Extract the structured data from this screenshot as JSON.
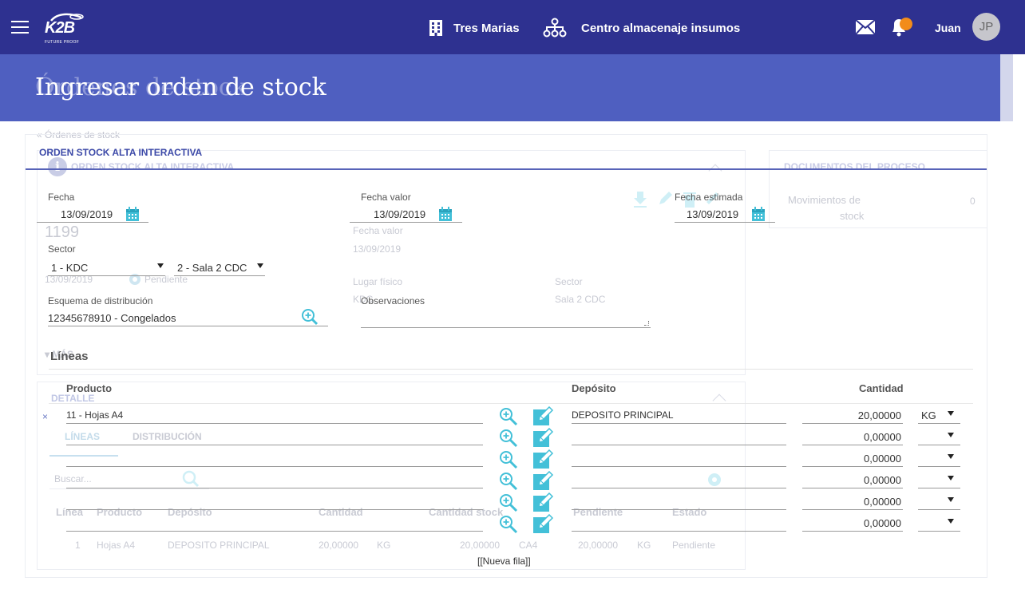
{
  "header": {
    "logo_text": "K2B",
    "logo_subtext": "FUTURE PROOF",
    "company": "Tres Marias",
    "location": "Centro almacenaje insumos",
    "user_name": "Juan",
    "user_initials": "JP",
    "notification_color": "#f28c1a",
    "brand_color": "#2e3190"
  },
  "page": {
    "title": "Ingresar orden de stock",
    "ghost_title": "Órdenes de stock"
  },
  "background": {
    "breadcrumb": "« Órdenes de stock",
    "section_title": "ORDEN STOCK ALTA INTERACTIVA",
    "docs_title": "DOCUMENTOS DEL PROCESO",
    "docs_item": "Movimientos de",
    "docs_item2": "stock",
    "docs_count": "0",
    "number": "1199",
    "fecha_valor_label": "Fecha valor",
    "fecha_valor_value": "13/09/2019",
    "date_value": "13/09/2019",
    "status": "Pendiente",
    "lugar_label": "Lugar físico",
    "lugar_value": "KDC",
    "sector_label": "Sector",
    "sector_value": "Sala 2 CDC",
    "mas": "MÁS",
    "detalle": "DETALLE",
    "tab_lineas": "LÍNEAS",
    "tab_distribucion": "DISTRIBUCIÓN",
    "search_placeholder": "Buscar...",
    "columns": [
      "Línea",
      "Producto",
      "Depósito",
      "Cantidad",
      "Cantidad stock",
      "Pendiente",
      "Estado"
    ],
    "row": [
      "1",
      "Hojas A4",
      "DEPOSITO PRINCIPAL",
      "20,00000",
      "KG",
      "20,00000",
      "CA4",
      "20,00000",
      "KG",
      "Pendiente"
    ]
  },
  "form": {
    "section_title": "ORDEN STOCK ALTA INTERACTIVA",
    "fecha_label": "Fecha",
    "fecha_value": "13/09/2019",
    "fecha_valor_label": "Fecha valor",
    "fecha_valor_value": "13/09/2019",
    "fecha_estimada_label": "Fecha estimada",
    "fecha_estimada_value": "13/09/2019",
    "sector_label": "Sector",
    "sector_value_1": "1 - KDC",
    "sector_value_2": "2 - Sala 2 CDC",
    "esquema_label": "Esquema de distribución",
    "esquema_value": "12345678910 - Congelados",
    "observaciones_label": "Observaciones",
    "observaciones_value": ""
  },
  "lines": {
    "title": "Líneas",
    "headers": {
      "producto": "Producto",
      "deposito": "Depósito",
      "cantidad": "Cantidad"
    },
    "remove_symbol": "×",
    "rows": [
      {
        "producto": "11 - Hojas A4",
        "deposito": "DEPOSITO PRINCIPAL",
        "cantidad": "20,00000",
        "unidad": "KG"
      },
      {
        "producto": "",
        "deposito": "",
        "cantidad": "0,00000",
        "unidad": ""
      },
      {
        "producto": "",
        "deposito": "",
        "cantidad": "0,00000",
        "unidad": ""
      },
      {
        "producto": "",
        "deposito": "",
        "cantidad": "0,00000",
        "unidad": ""
      },
      {
        "producto": "",
        "deposito": "",
        "cantidad": "0,00000",
        "unidad": ""
      },
      {
        "producto": "",
        "deposito": "",
        "cantidad": "0,00000",
        "unidad": ""
      }
    ],
    "new_row_label": "[[Nueva fila]]"
  },
  "icons": {
    "accent": "#43c0d8",
    "calendar": "calendar-icon",
    "zoom": "zoom-in-icon",
    "edit": "edit-icon"
  }
}
